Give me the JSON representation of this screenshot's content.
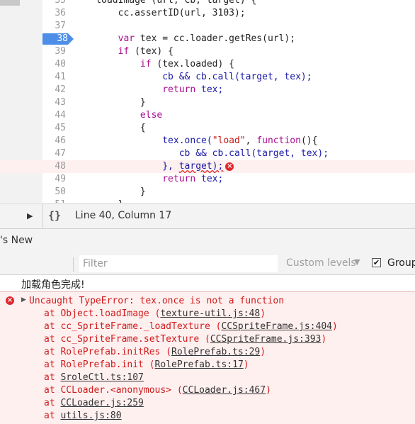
{
  "editor": {
    "lines": [
      {
        "n": "35",
        "top": 0
      },
      {
        "n": "36"
      },
      {
        "n": "37"
      },
      {
        "n": "38"
      },
      {
        "n": "39"
      },
      {
        "n": "40"
      },
      {
        "n": "41"
      },
      {
        "n": "42"
      },
      {
        "n": "43"
      },
      {
        "n": "44"
      },
      {
        "n": "45"
      },
      {
        "n": "46"
      },
      {
        "n": "47"
      },
      {
        "n": "48"
      },
      {
        "n": "49"
      },
      {
        "n": "50"
      },
      {
        "n": "51"
      }
    ],
    "code": {
      "l35": "    loadImage (url, cb, target) {",
      "l36": "        cc.assertID(url, 3103);",
      "l38a": "var",
      "l38b": " tex = cc.loader.getRes(url);",
      "l39a": "if",
      "l39b": " (tex) {",
      "l40a": "if",
      "l40b": " (tex.loaded) {",
      "l41": "cb && cb.call(target, tex);",
      "l42a": "return",
      "l42b": " tex;",
      "l43": "}",
      "l44": "else",
      "l45": "{",
      "l46a": "tex.once(",
      "l46b": "\"load\"",
      "l46c": ", ",
      "l46d": "function",
      "l46e": "(){",
      "l47": "cb && cb.call(target, tex);",
      "l48a": "}, ",
      "l48b": "target);",
      "l49a": "return",
      "l49b": " tex;",
      "l50": "}",
      "l51": "}"
    }
  },
  "status": {
    "braces": "{}",
    "position": "Line 40, Column 17"
  },
  "tabbar": {
    "tab_label": "'s New"
  },
  "filter": {
    "placeholder": "Filter",
    "levels_label": "Custom levels",
    "group_label": "Group",
    "group_checked": true
  },
  "console": {
    "log_message": "加载角色完成!",
    "error_message": "Uncaught TypeError: tex.once is not a function",
    "stack": [
      {
        "prefix": "at Object.loadImage (",
        "link": "texture-util.js:48",
        "suffix": ")"
      },
      {
        "prefix": "at cc_SpriteFrame._loadTexture (",
        "link": "CCSpriteFrame.js:404",
        "suffix": ")"
      },
      {
        "prefix": "at cc_SpriteFrame.setTexture (",
        "link": "CCSpriteFrame.js:393",
        "suffix": ")"
      },
      {
        "prefix": "at RolePrefab.initRes (",
        "link": "RolePrefab.ts:29",
        "suffix": ")"
      },
      {
        "prefix": "at RolePrefab.init (",
        "link": "RolePrefab.ts:17",
        "suffix": ")"
      },
      {
        "prefix": "at ",
        "link": "SroleCtl.ts:107",
        "suffix": ""
      },
      {
        "prefix": "at CCLoader.<anonymous> (",
        "link": "CCLoader.js:467",
        "suffix": ")"
      },
      {
        "prefix": "at ",
        "link": "CCLoader.js:259",
        "suffix": ""
      },
      {
        "prefix": "at ",
        "link": "utils.js:80",
        "suffix": ""
      }
    ]
  },
  "colors": {
    "breakpoint": "#4d8fe8",
    "error": "#d01b1b",
    "error_bg": "#fff0f0"
  }
}
